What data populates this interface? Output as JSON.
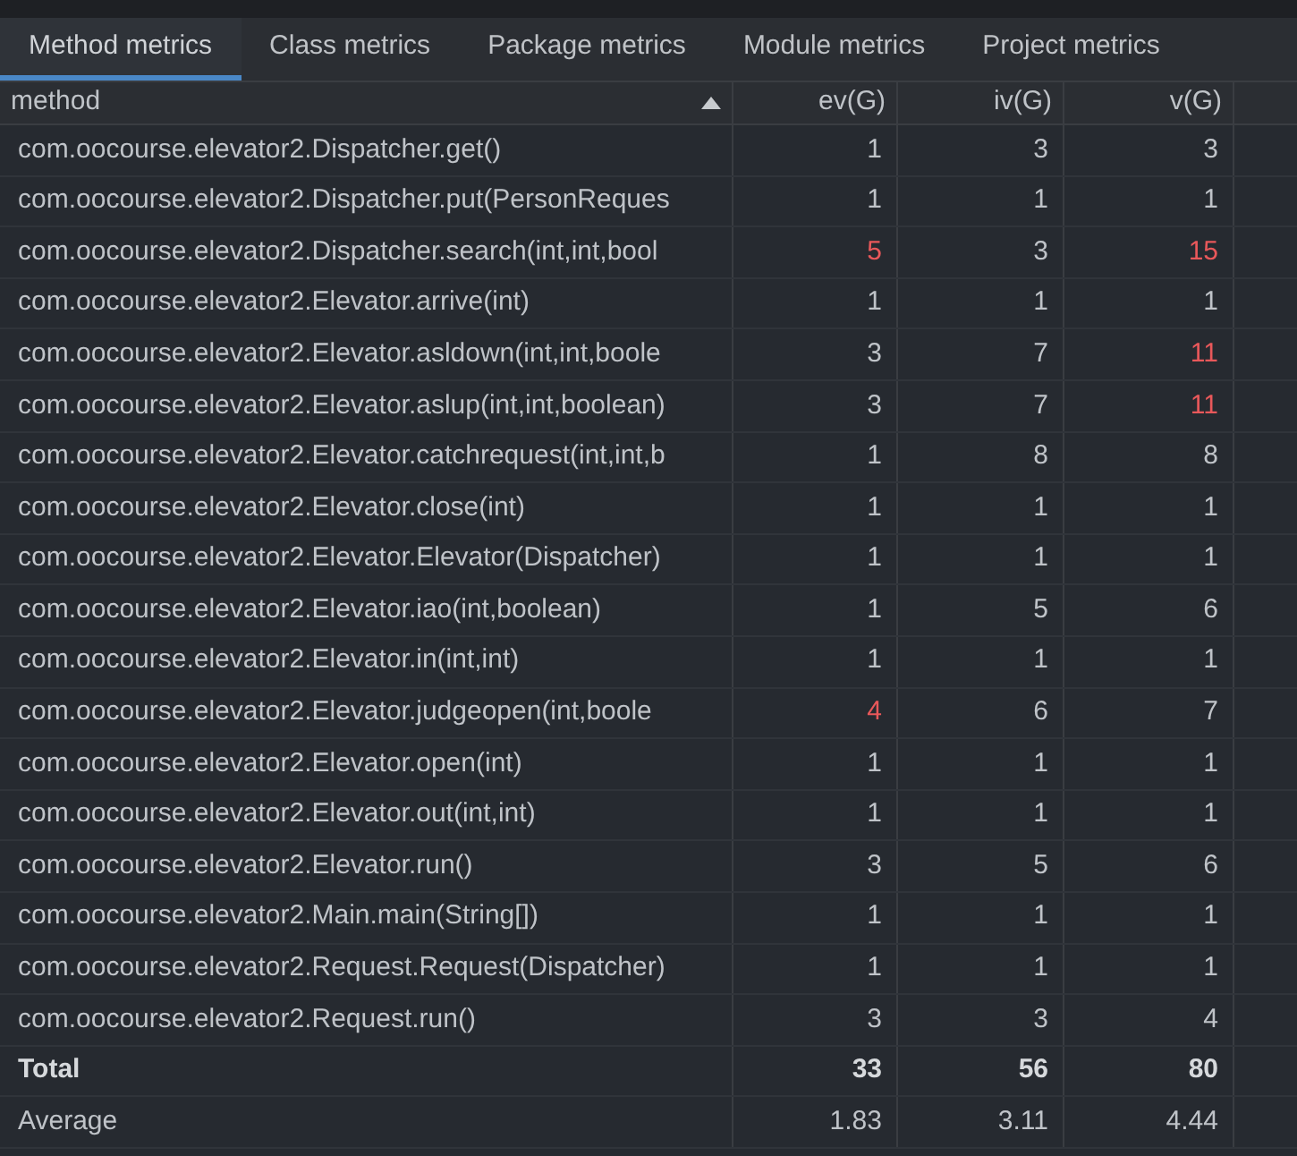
{
  "tabs": [
    {
      "label": "Method metrics",
      "selected": true
    },
    {
      "label": "Class metrics",
      "selected": false
    },
    {
      "label": "Package metrics",
      "selected": false
    },
    {
      "label": "Module metrics",
      "selected": false
    },
    {
      "label": "Project metrics",
      "selected": false
    }
  ],
  "table": {
    "columns": [
      {
        "label": "method",
        "sorted": true
      },
      {
        "label": "ev(G)",
        "sorted": false
      },
      {
        "label": "iv(G)",
        "sorted": false
      },
      {
        "label": "v(G)",
        "sorted": false
      }
    ],
    "rows": [
      {
        "kind": "method",
        "cells": [
          {
            "text": "com.oocourse.elevator2.Dispatcher.get()"
          },
          {
            "text": "1",
            "flagged": false
          },
          {
            "text": "3",
            "flagged": false
          },
          {
            "text": "3",
            "flagged": false
          }
        ]
      },
      {
        "kind": "method",
        "cells": [
          {
            "text": "com.oocourse.elevator2.Dispatcher.put(PersonReques"
          },
          {
            "text": "1",
            "flagged": false
          },
          {
            "text": "1",
            "flagged": false
          },
          {
            "text": "1",
            "flagged": false
          }
        ]
      },
      {
        "kind": "method",
        "cells": [
          {
            "text": "com.oocourse.elevator2.Dispatcher.search(int,int,bool"
          },
          {
            "text": "5",
            "flagged": true
          },
          {
            "text": "3",
            "flagged": false
          },
          {
            "text": "15",
            "flagged": true
          }
        ]
      },
      {
        "kind": "method",
        "cells": [
          {
            "text": "com.oocourse.elevator2.Elevator.arrive(int)"
          },
          {
            "text": "1",
            "flagged": false
          },
          {
            "text": "1",
            "flagged": false
          },
          {
            "text": "1",
            "flagged": false
          }
        ]
      },
      {
        "kind": "method",
        "cells": [
          {
            "text": "com.oocourse.elevator2.Elevator.asldown(int,int,boole"
          },
          {
            "text": "3",
            "flagged": false
          },
          {
            "text": "7",
            "flagged": false
          },
          {
            "text": "11",
            "flagged": true
          }
        ]
      },
      {
        "kind": "method",
        "cells": [
          {
            "text": "com.oocourse.elevator2.Elevator.aslup(int,int,boolean)"
          },
          {
            "text": "3",
            "flagged": false
          },
          {
            "text": "7",
            "flagged": false
          },
          {
            "text": "11",
            "flagged": true
          }
        ]
      },
      {
        "kind": "method",
        "cells": [
          {
            "text": "com.oocourse.elevator2.Elevator.catchrequest(int,int,b"
          },
          {
            "text": "1",
            "flagged": false
          },
          {
            "text": "8",
            "flagged": false
          },
          {
            "text": "8",
            "flagged": false
          }
        ]
      },
      {
        "kind": "method",
        "cells": [
          {
            "text": "com.oocourse.elevator2.Elevator.close(int)"
          },
          {
            "text": "1",
            "flagged": false
          },
          {
            "text": "1",
            "flagged": false
          },
          {
            "text": "1",
            "flagged": false
          }
        ]
      },
      {
        "kind": "method",
        "cells": [
          {
            "text": "com.oocourse.elevator2.Elevator.Elevator(Dispatcher)"
          },
          {
            "text": "1",
            "flagged": false
          },
          {
            "text": "1",
            "flagged": false
          },
          {
            "text": "1",
            "flagged": false
          }
        ]
      },
      {
        "kind": "method",
        "cells": [
          {
            "text": "com.oocourse.elevator2.Elevator.iao(int,boolean)"
          },
          {
            "text": "1",
            "flagged": false
          },
          {
            "text": "5",
            "flagged": false
          },
          {
            "text": "6",
            "flagged": false
          }
        ]
      },
      {
        "kind": "method",
        "cells": [
          {
            "text": "com.oocourse.elevator2.Elevator.in(int,int)"
          },
          {
            "text": "1",
            "flagged": false
          },
          {
            "text": "1",
            "flagged": false
          },
          {
            "text": "1",
            "flagged": false
          }
        ]
      },
      {
        "kind": "method",
        "cells": [
          {
            "text": "com.oocourse.elevator2.Elevator.judgeopen(int,boole"
          },
          {
            "text": "4",
            "flagged": true
          },
          {
            "text": "6",
            "flagged": false
          },
          {
            "text": "7",
            "flagged": false
          }
        ]
      },
      {
        "kind": "method",
        "cells": [
          {
            "text": "com.oocourse.elevator2.Elevator.open(int)"
          },
          {
            "text": "1",
            "flagged": false
          },
          {
            "text": "1",
            "flagged": false
          },
          {
            "text": "1",
            "flagged": false
          }
        ]
      },
      {
        "kind": "method",
        "cells": [
          {
            "text": "com.oocourse.elevator2.Elevator.out(int,int)"
          },
          {
            "text": "1",
            "flagged": false
          },
          {
            "text": "1",
            "flagged": false
          },
          {
            "text": "1",
            "flagged": false
          }
        ]
      },
      {
        "kind": "method",
        "cells": [
          {
            "text": "com.oocourse.elevator2.Elevator.run()"
          },
          {
            "text": "3",
            "flagged": false
          },
          {
            "text": "5",
            "flagged": false
          },
          {
            "text": "6",
            "flagged": false
          }
        ]
      },
      {
        "kind": "method",
        "cells": [
          {
            "text": "com.oocourse.elevator2.Main.main(String[])"
          },
          {
            "text": "1",
            "flagged": false
          },
          {
            "text": "1",
            "flagged": false
          },
          {
            "text": "1",
            "flagged": false
          }
        ]
      },
      {
        "kind": "method",
        "cells": [
          {
            "text": "com.oocourse.elevator2.Request.Request(Dispatcher)"
          },
          {
            "text": "1",
            "flagged": false
          },
          {
            "text": "1",
            "flagged": false
          },
          {
            "text": "1",
            "flagged": false
          }
        ]
      },
      {
        "kind": "method",
        "cells": [
          {
            "text": "com.oocourse.elevator2.Request.run()"
          },
          {
            "text": "3",
            "flagged": false
          },
          {
            "text": "3",
            "flagged": false
          },
          {
            "text": "4",
            "flagged": false
          }
        ]
      },
      {
        "kind": "total",
        "cells": [
          {
            "text": "Total"
          },
          {
            "text": "33",
            "flagged": false
          },
          {
            "text": "56",
            "flagged": false
          },
          {
            "text": "80",
            "flagged": false
          }
        ]
      },
      {
        "kind": "average",
        "cells": [
          {
            "text": "Average"
          },
          {
            "text": "1.83",
            "flagged": false
          },
          {
            "text": "3.11",
            "flagged": false
          },
          {
            "text": "4.44",
            "flagged": false
          }
        ]
      }
    ]
  }
}
